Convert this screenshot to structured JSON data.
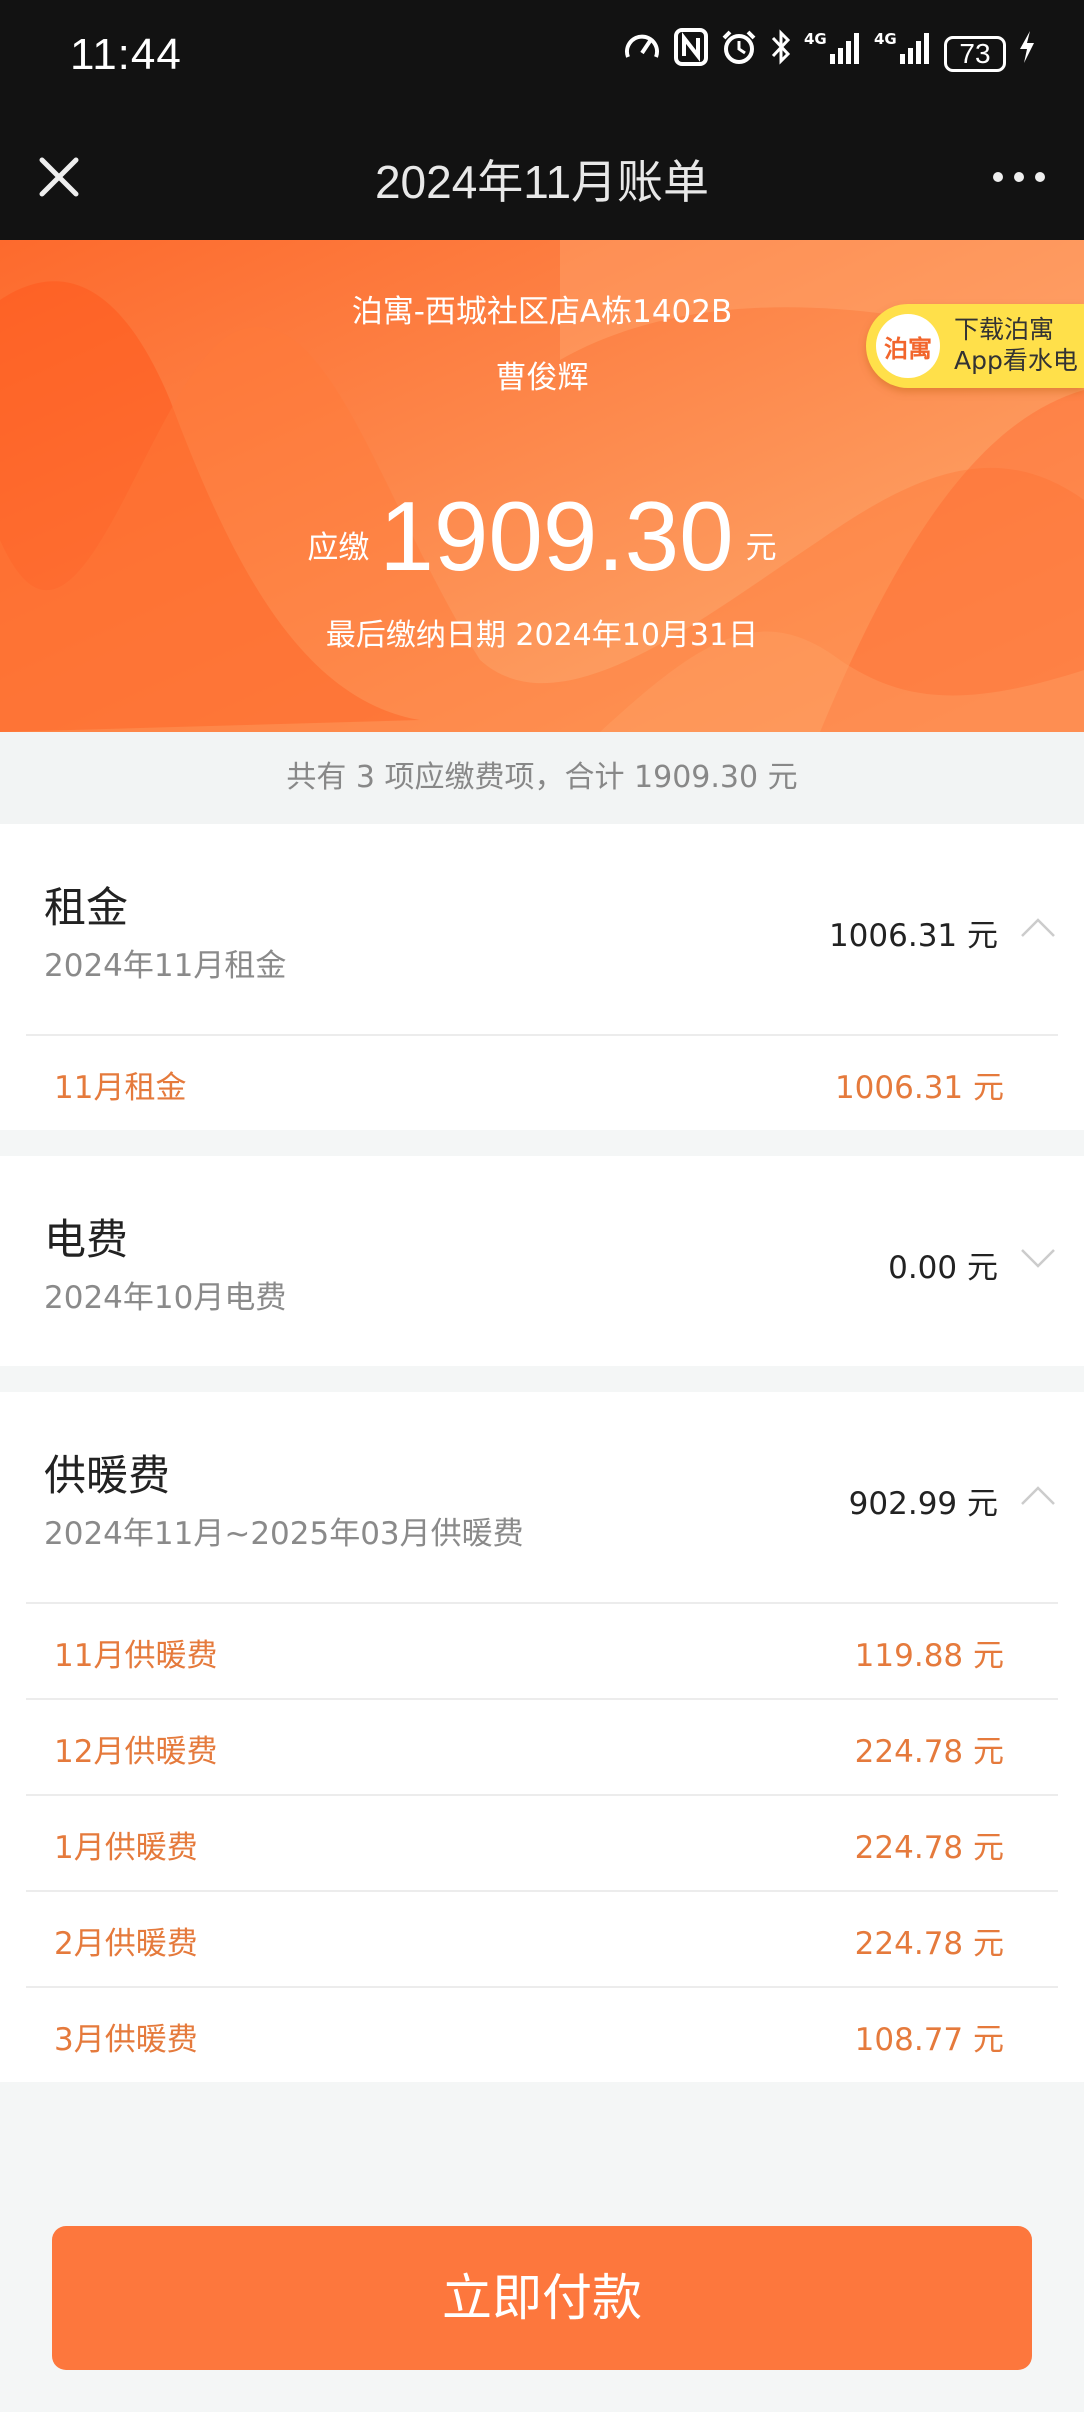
{
  "status_bar": {
    "time": "11:44",
    "battery": "73",
    "network": "4G"
  },
  "nav": {
    "title": "2024年11月账单"
  },
  "hero": {
    "address": "泊寓-西城社区店A栋1402B",
    "tenant": "曹俊辉",
    "amount_label": "应缴",
    "amount": "1909.30",
    "amount_unit": "元",
    "due_date": "最后缴纳日期 2024年10月31日",
    "badge_logo": "泊寓",
    "badge_line1": "下载泊寓",
    "badge_line2": "App看水电"
  },
  "summary": "共有 3 项应缴费项，合计 1909.30 元",
  "items": [
    {
      "name": "租金",
      "period": "2024年11月租金",
      "total": "1006.31 元",
      "expanded": true,
      "details": [
        {
          "name": "11月租金",
          "amount": "1006.31 元"
        }
      ]
    },
    {
      "name": "电费",
      "period": "2024年10月电费",
      "total": "0.00 元",
      "expanded": false,
      "details": []
    },
    {
      "name": "供暖费",
      "period": "2024年11月~2025年03月供暖费",
      "total": "902.99 元",
      "expanded": true,
      "details": [
        {
          "name": "11月供暖费",
          "amount": "119.88 元"
        },
        {
          "name": "12月供暖费",
          "amount": "224.78 元"
        },
        {
          "name": "1月供暖费",
          "amount": "224.78 元"
        },
        {
          "name": "2月供暖费",
          "amount": "224.78 元"
        },
        {
          "name": "3月供暖费",
          "amount": "108.77 元"
        }
      ]
    }
  ],
  "pay_button": "立即付款",
  "colors": {
    "accent": "#fd773d",
    "detail_text": "#e57a3c",
    "hero": "#fb8442"
  }
}
